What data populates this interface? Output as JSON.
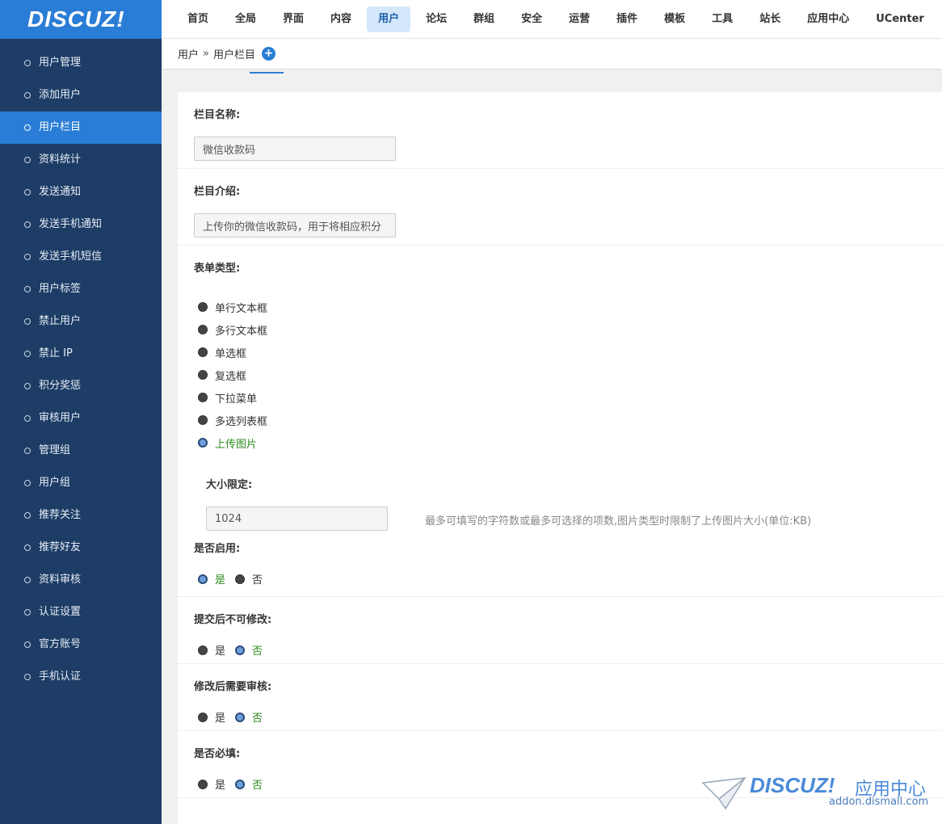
{
  "logo": {
    "text": "DISCUZ!"
  },
  "topnav": [
    {
      "label": "首页",
      "active": false
    },
    {
      "label": "全局",
      "active": false
    },
    {
      "label": "界面",
      "active": false
    },
    {
      "label": "内容",
      "active": false
    },
    {
      "label": "用户",
      "active": true
    },
    {
      "label": "论坛",
      "active": false
    },
    {
      "label": "群组",
      "active": false
    },
    {
      "label": "安全",
      "active": false
    },
    {
      "label": "运营",
      "active": false
    },
    {
      "label": "插件",
      "active": false
    },
    {
      "label": "模板",
      "active": false
    },
    {
      "label": "工具",
      "active": false
    },
    {
      "label": "站长",
      "active": false
    },
    {
      "label": "应用中心",
      "active": false
    },
    {
      "label": "UCenter",
      "active": false
    }
  ],
  "sidebar": [
    {
      "label": "用户管理",
      "active": false
    },
    {
      "label": "添加用户",
      "active": false
    },
    {
      "label": "用户栏目",
      "active": true
    },
    {
      "label": "资料统计",
      "active": false
    },
    {
      "label": "发送通知",
      "active": false
    },
    {
      "label": "发送手机通知",
      "active": false
    },
    {
      "label": "发送手机短信",
      "active": false
    },
    {
      "label": "用户标签",
      "active": false
    },
    {
      "label": "禁止用户",
      "active": false
    },
    {
      "label": "禁止 IP",
      "active": false
    },
    {
      "label": "积分奖惩",
      "active": false
    },
    {
      "label": "审核用户",
      "active": false
    },
    {
      "label": "管理组",
      "active": false
    },
    {
      "label": "用户组",
      "active": false
    },
    {
      "label": "推荐关注",
      "active": false
    },
    {
      "label": "推荐好友",
      "active": false
    },
    {
      "label": "资料审核",
      "active": false
    },
    {
      "label": "认证设置",
      "active": false
    },
    {
      "label": "官方账号",
      "active": false
    },
    {
      "label": "手机认证",
      "active": false
    }
  ],
  "breadcrumb": {
    "parent": "用户",
    "sep": "»",
    "current": "用户栏目",
    "add_icon": "+"
  },
  "form": {
    "name_label": "栏目名称:",
    "name_value": "微信收款码",
    "intro_label": "栏目介绍:",
    "intro_value": "上传你的微信收款码，用于将相应积分",
    "type_label": "表单类型:",
    "type_options": [
      {
        "label": "单行文本框",
        "checked": false
      },
      {
        "label": "多行文本框",
        "checked": false
      },
      {
        "label": "单选框",
        "checked": false
      },
      {
        "label": "复选框",
        "checked": false
      },
      {
        "label": "下拉菜单",
        "checked": false
      },
      {
        "label": "多选列表框",
        "checked": false
      },
      {
        "label": "上传图片",
        "checked": true
      }
    ],
    "size_label": "大小限定:",
    "size_value": "1024",
    "size_hint": "最多可填写的字符数或最多可选择的项数,图片类型时限制了上传图片大小(单位:KB)",
    "enabled_label": "是否启用:",
    "readonly_label": "提交后不可修改:",
    "review_label": "修改后需要审核:",
    "required_label": "是否必填:",
    "yes": "是",
    "no": "否",
    "enabled": "yes",
    "readonly": "no",
    "review": "no",
    "required": "no"
  },
  "watermark": {
    "brand": "DISCUZ!",
    "cn": "应用中心",
    "url": "addon.dismall.com"
  },
  "colors": {
    "accent": "#2a7dd6",
    "sidebar": "#1d3d66",
    "checked_text": "#2d8a1e"
  }
}
